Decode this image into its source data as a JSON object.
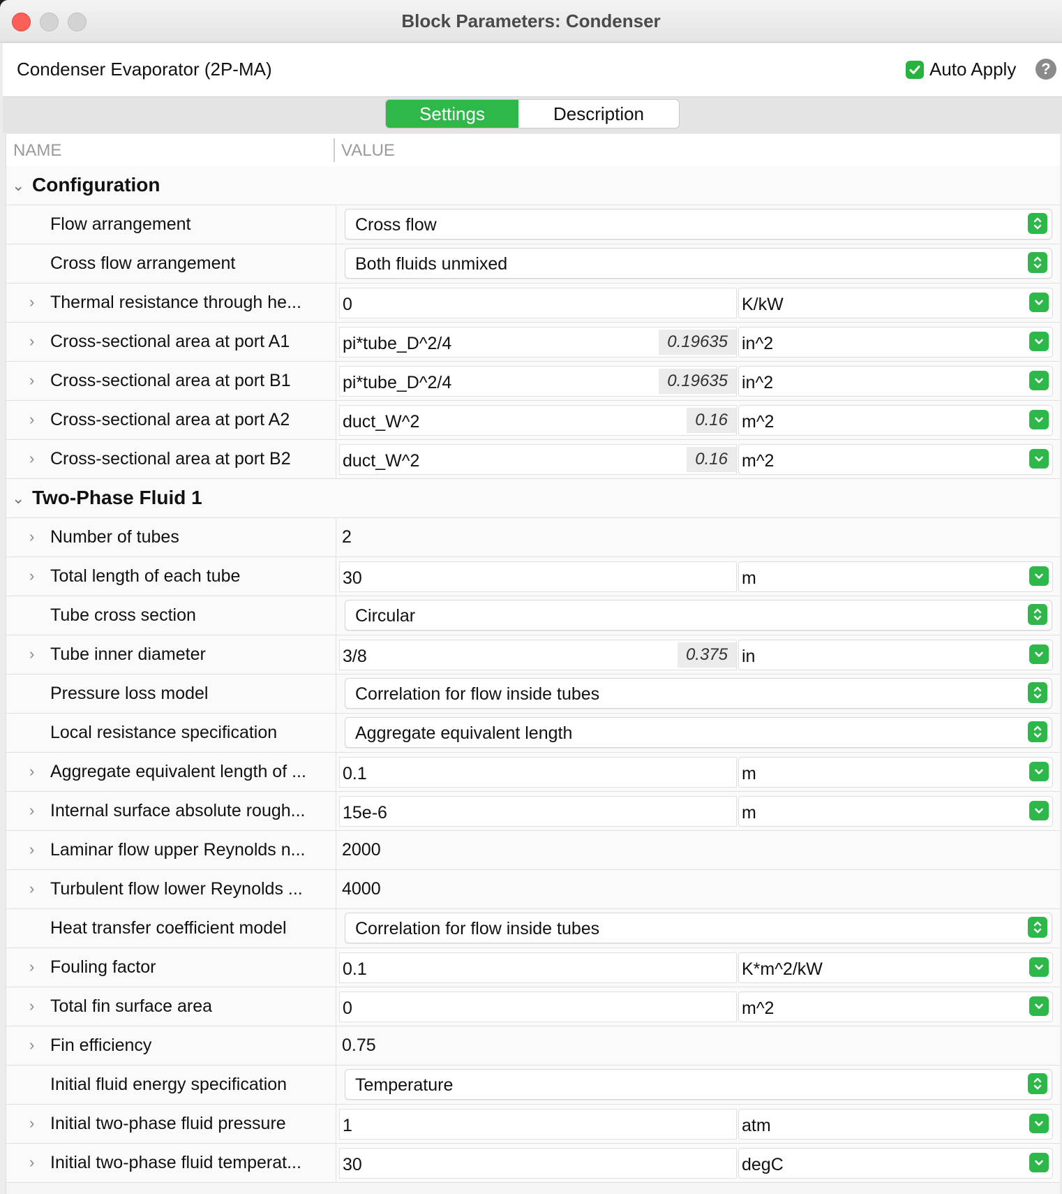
{
  "window": {
    "title": "Block Parameters: Condenser"
  },
  "header": {
    "block_name": "Condenser Evaporator (2P-MA)",
    "auto_apply_label": "Auto Apply",
    "auto_apply_checked": true,
    "help_icon": "question-mark-icon"
  },
  "tabs": [
    {
      "label": "Settings",
      "active": true
    },
    {
      "label": "Description",
      "active": false
    }
  ],
  "columns": {
    "name": "NAME",
    "value": "VALUE"
  },
  "accent_color": "#2fb84a",
  "rows": [
    {
      "kind": "group",
      "label": "Configuration",
      "expanded": true
    },
    {
      "kind": "popup",
      "label": "Flow arrangement",
      "value": "Cross flow"
    },
    {
      "kind": "popup",
      "label": "Cross flow arrangement",
      "value": "Both fluids unmixed"
    },
    {
      "kind": "unit",
      "label": "Thermal resistance through he...",
      "value": "0",
      "eval": "",
      "unit": "K/kW"
    },
    {
      "kind": "unit",
      "label": "Cross-sectional area at port A1",
      "value": "pi*tube_D^2/4",
      "eval": "0.19635",
      "unit": "in^2"
    },
    {
      "kind": "unit",
      "label": "Cross-sectional area at port B1",
      "value": "pi*tube_D^2/4",
      "eval": "0.19635",
      "unit": "in^2"
    },
    {
      "kind": "unit",
      "label": "Cross-sectional area at port A2",
      "value": "duct_W^2",
      "eval": "0.16",
      "unit": "m^2"
    },
    {
      "kind": "unit",
      "label": "Cross-sectional area at port B2",
      "value": "duct_W^2",
      "eval": "0.16",
      "unit": "m^2"
    },
    {
      "kind": "group",
      "label": "Two-Phase Fluid 1",
      "expanded": true
    },
    {
      "kind": "plain",
      "label": "Number of tubes",
      "value": "2"
    },
    {
      "kind": "unit",
      "label": "Total length of each tube",
      "value": "30",
      "eval": "",
      "unit": "m"
    },
    {
      "kind": "popup",
      "label": "Tube cross section",
      "value": "Circular"
    },
    {
      "kind": "unit",
      "label": "Tube inner diameter",
      "value": "3/8",
      "eval": "0.375",
      "unit": "in"
    },
    {
      "kind": "popup",
      "label": "Pressure loss model",
      "value": "Correlation for flow inside tubes"
    },
    {
      "kind": "popup",
      "label": "Local resistance specification",
      "value": "Aggregate equivalent length"
    },
    {
      "kind": "unit",
      "label": "Aggregate equivalent length of ...",
      "value": "0.1",
      "eval": "",
      "unit": "m"
    },
    {
      "kind": "unit",
      "label": "Internal surface absolute rough...",
      "value": "15e-6",
      "eval": "",
      "unit": "m"
    },
    {
      "kind": "plain",
      "label": "Laminar flow upper Reynolds n...",
      "value": "2000"
    },
    {
      "kind": "plain",
      "label": "Turbulent flow lower Reynolds ...",
      "value": "4000"
    },
    {
      "kind": "popup",
      "label": "Heat transfer coefficient model",
      "value": "Correlation for flow inside tubes"
    },
    {
      "kind": "unit",
      "label": "Fouling factor",
      "value": "0.1",
      "eval": "",
      "unit": "K*m^2/kW"
    },
    {
      "kind": "unit",
      "label": "Total fin surface area",
      "value": "0",
      "eval": "",
      "unit": "m^2"
    },
    {
      "kind": "plain",
      "label": "Fin efficiency",
      "value": "0.75"
    },
    {
      "kind": "popup",
      "label": "Initial fluid energy specification",
      "value": "Temperature"
    },
    {
      "kind": "unit",
      "label": "Initial two-phase fluid pressure",
      "value": "1",
      "eval": "",
      "unit": "atm"
    },
    {
      "kind": "unit",
      "label": "Initial two-phase fluid temperat...",
      "value": "30",
      "eval": "",
      "unit": "degC"
    }
  ]
}
